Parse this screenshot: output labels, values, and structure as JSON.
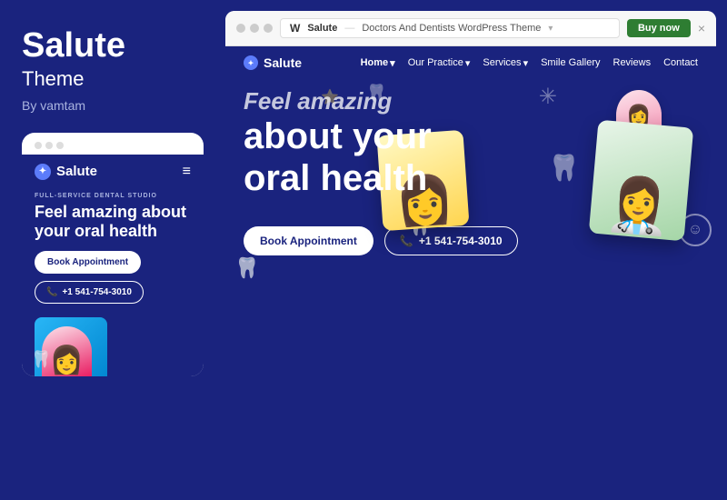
{
  "left": {
    "brand": {
      "title": "Salute",
      "subtitle": "Theme",
      "by": "By vamtam"
    },
    "mobile_card": {
      "dots": [
        "dot1",
        "dot2",
        "dot3"
      ],
      "logo": "Salute",
      "service_tag": "Full-Service Dental Studio",
      "headline": "Feel amazing about your oral health",
      "btn_appointment": "Book Appointment",
      "btn_phone": "+1 541-754-3010"
    }
  },
  "right": {
    "browser": {
      "site_name": "Salute",
      "address_label": "Doctors And Dentists WordPress Theme",
      "buy_label": "Buy now",
      "close": "×"
    },
    "nav": {
      "logo": "Salute",
      "links": [
        {
          "label": "Home",
          "active": true,
          "has_arrow": true
        },
        {
          "label": "Our Practice",
          "active": false,
          "has_arrow": true
        },
        {
          "label": "Services",
          "active": false,
          "has_arrow": true
        },
        {
          "label": "Smile Gallery",
          "active": false,
          "has_arrow": false
        },
        {
          "label": "Reviews",
          "active": false,
          "has_arrow": false
        },
        {
          "label": "Contact",
          "active": false,
          "has_arrow": false
        }
      ]
    },
    "hero": {
      "line1": "Feel amazing",
      "line2": "about your",
      "line3": "oral health",
      "btn_appointment": "Book Appointment",
      "btn_phone": "+1 541-754-3010"
    }
  }
}
